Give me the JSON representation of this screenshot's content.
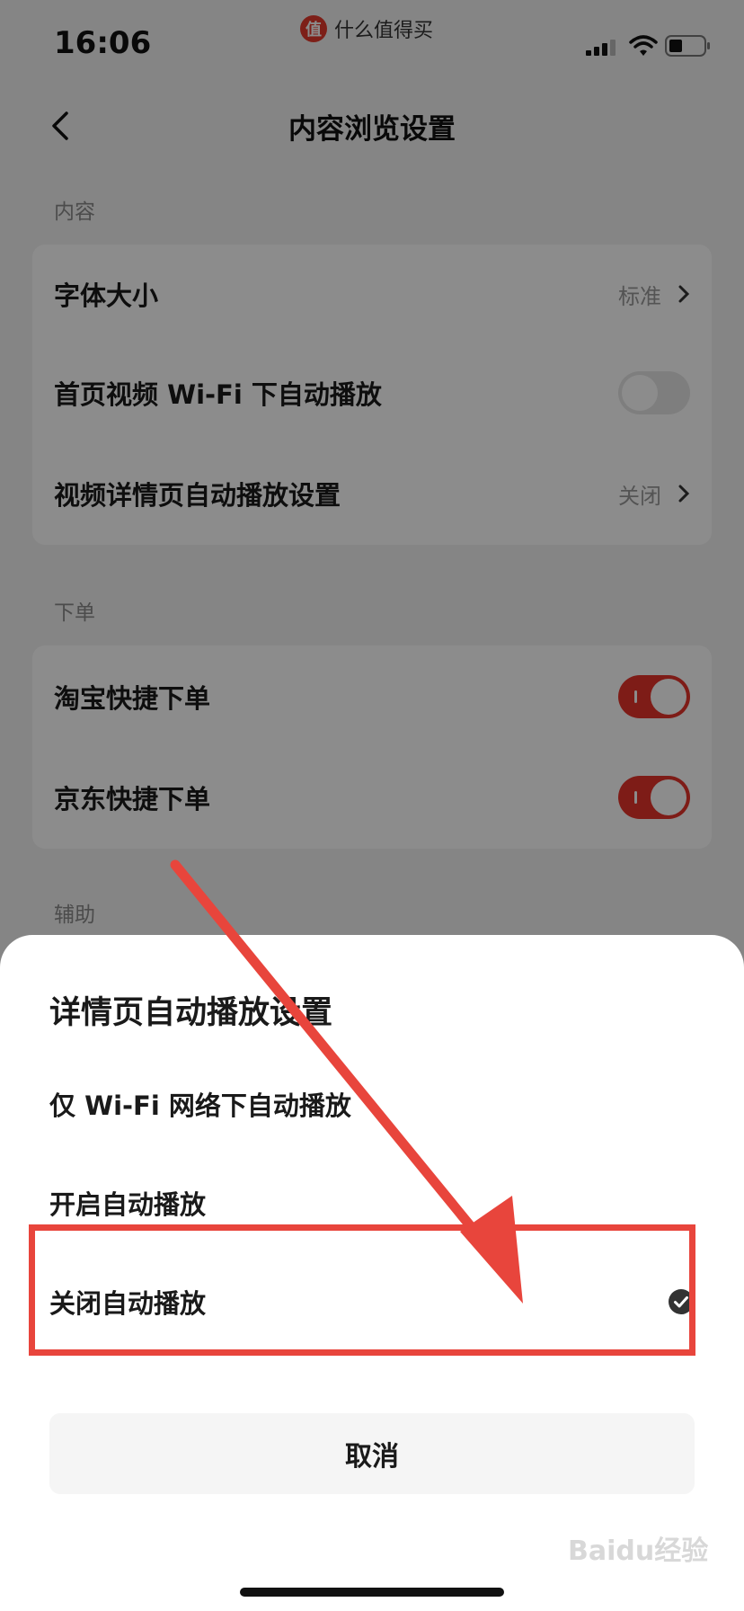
{
  "status_bar": {
    "time": "16:06",
    "app_name": "什么值得买",
    "app_logo_char": "值"
  },
  "nav": {
    "title": "内容浏览设置"
  },
  "sections": [
    {
      "label": "内容",
      "rows": [
        {
          "label": "字体大小",
          "value": "标准",
          "type": "link"
        },
        {
          "label": "首页视频 Wi-Fi 下自动播放",
          "type": "toggle",
          "on": false
        },
        {
          "label": "视频详情页自动播放设置",
          "value": "关闭",
          "type": "link"
        }
      ]
    },
    {
      "label": "下单",
      "rows": [
        {
          "label": "淘宝快捷下单",
          "type": "toggle",
          "on": true
        },
        {
          "label": "京东快捷下单",
          "type": "toggle",
          "on": true
        }
      ]
    },
    {
      "label": "辅助",
      "rows": []
    }
  ],
  "sheet": {
    "title": "详情页自动播放设置",
    "options": [
      {
        "label": "仅 Wi-Fi 网络下自动播放",
        "selected": false
      },
      {
        "label": "开启自动播放",
        "selected": false
      },
      {
        "label": "关闭自动播放",
        "selected": true
      }
    ],
    "cancel_label": "取消"
  },
  "watermark": "Baidu经验",
  "colors": {
    "accent": "#e5332a",
    "annotation": "#e8453c"
  }
}
